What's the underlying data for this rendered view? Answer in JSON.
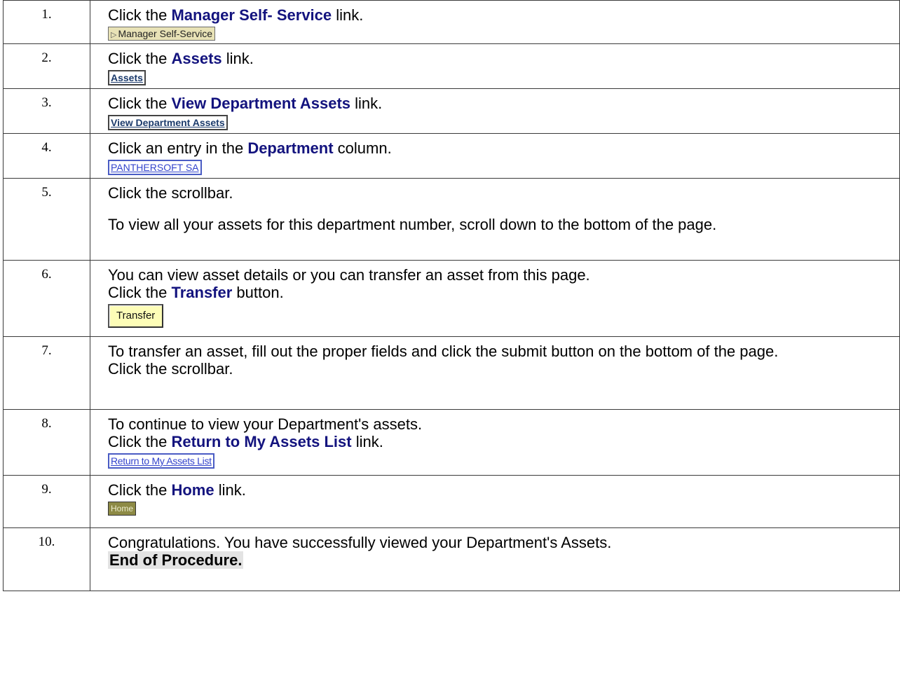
{
  "steps": [
    {
      "num": "1.",
      "pre": "Click the ",
      "bold": "Manager Self- Service",
      "post": " link.",
      "shot": "Manager Self-Service"
    },
    {
      "num": "2.",
      "pre": "Click the ",
      "bold": "Assets",
      "post": " link.",
      "shot": "Assets"
    },
    {
      "num": "3.",
      "pre": "Click the ",
      "bold": "View Department Assets",
      "post": " link.",
      "shot": "View Department Assets"
    },
    {
      "num": "4.",
      "pre": "Click an entry in the ",
      "bold": "Department",
      "post": " column.",
      "shot": "PANTHERSOFT SA"
    },
    {
      "num": "5.",
      "text": "Click the scrollbar.",
      "text2": "To view all your assets for this department number, scroll down to the bottom of the page."
    },
    {
      "num": "6.",
      "text": "You can view asset details or you can transfer an asset from this page.",
      "pre": "Click the ",
      "bold": "Transfer",
      "post": " button.",
      "shot": "Transfer"
    },
    {
      "num": "7.",
      "text": "To transfer an asset, fill out the proper fields and click the submit button on the bottom of the page.",
      "text2": "Click the scrollbar."
    },
    {
      "num": "8.",
      "text": "To continue to view your Department's assets.",
      "pre": "Click the ",
      "bold": "Return to My Assets List",
      "post": " link.",
      "shot": "Return to My Assets List"
    },
    {
      "num": "9.",
      "pre": "Click the ",
      "bold": "Home",
      "post": " link.",
      "shot": "Home"
    },
    {
      "num": "10.",
      "text": "Congratulations. You have successfully viewed your Department's Assets.",
      "end": "End of Procedure."
    }
  ]
}
